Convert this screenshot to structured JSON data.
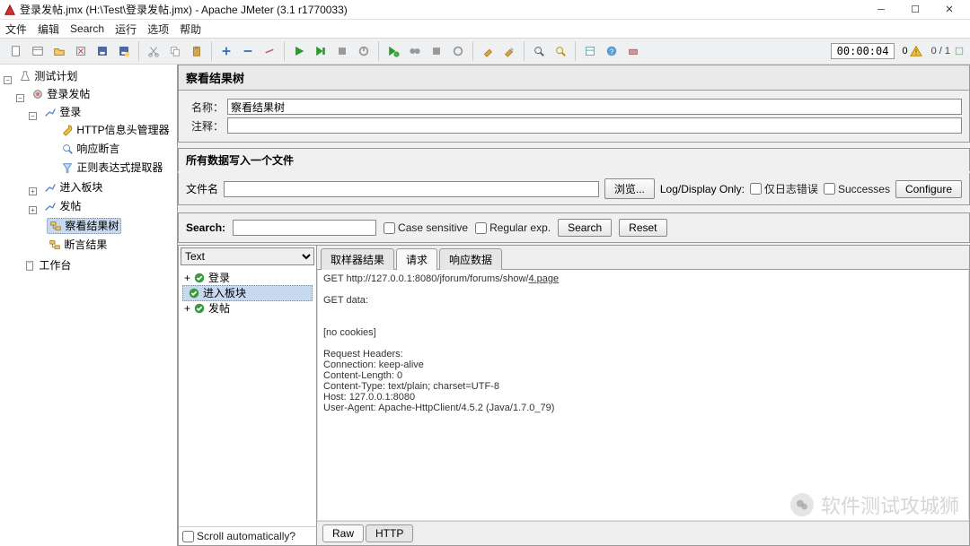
{
  "window": {
    "title": "登录发帖.jmx (H:\\Test\\登录发帖.jmx) - Apache JMeter (3.1 r1770033)",
    "timer": "00:00:04",
    "warn_count": "0",
    "thread_count": "0 / 1"
  },
  "menu": {
    "items": [
      "文件",
      "编辑",
      "Search",
      "运行",
      "选项",
      "帮助"
    ]
  },
  "tree": {
    "root": "测试计划",
    "group": "登录发帖",
    "login": "登录",
    "http_header": "HTTP信息头管理器",
    "resp_assert": "响应断言",
    "regex_extract": "正则表达式提取器",
    "enter_forum": "进入板块",
    "post": "发帖",
    "view_results": "察看结果树",
    "assert_results": "断言结果",
    "workbench": "工作台"
  },
  "panel": {
    "title": "察看结果树",
    "name_label": "名称：",
    "name_value": "察看结果树",
    "comment_label": "注释：",
    "comment_value": "",
    "section": "所有数据写入一个文件",
    "file_label": "文件名",
    "file_value": "",
    "browse": "浏览...",
    "log_only": "Log/Display Only:",
    "only_errors": "仅日志错误",
    "successes": "Successes",
    "configure": "Configure"
  },
  "search": {
    "label": "Search:",
    "value": "",
    "case_sensitive": "Case sensitive",
    "regex": "Regular exp.",
    "search_btn": "Search",
    "reset_btn": "Reset"
  },
  "results": {
    "combo": "Text",
    "samples": [
      "登录",
      "进入板块",
      "发帖"
    ],
    "scroll_auto": "Scroll automatically?",
    "tabs": [
      "取样器结果",
      "请求",
      "响应数据"
    ],
    "active_tab": 1,
    "bottom_tabs": [
      "Raw",
      "HTTP"
    ],
    "active_bottom": 0,
    "request_line": "GET http://127.0.0.1:8080/jforum/forums/show/",
    "request_tail": "4.page",
    "get_data": "GET data:",
    "no_cookies": "[no cookies]",
    "req_headers_label": "Request Headers:",
    "headers": [
      "Connection: keep-alive",
      "Content-Length: 0",
      "Content-Type: text/plain; charset=UTF-8",
      "Host: 127.0.0.1:8080",
      "User-Agent: Apache-HttpClient/4.5.2 (Java/1.7.0_79)"
    ]
  },
  "watermark": {
    "text": "软件测试攻城狮"
  }
}
